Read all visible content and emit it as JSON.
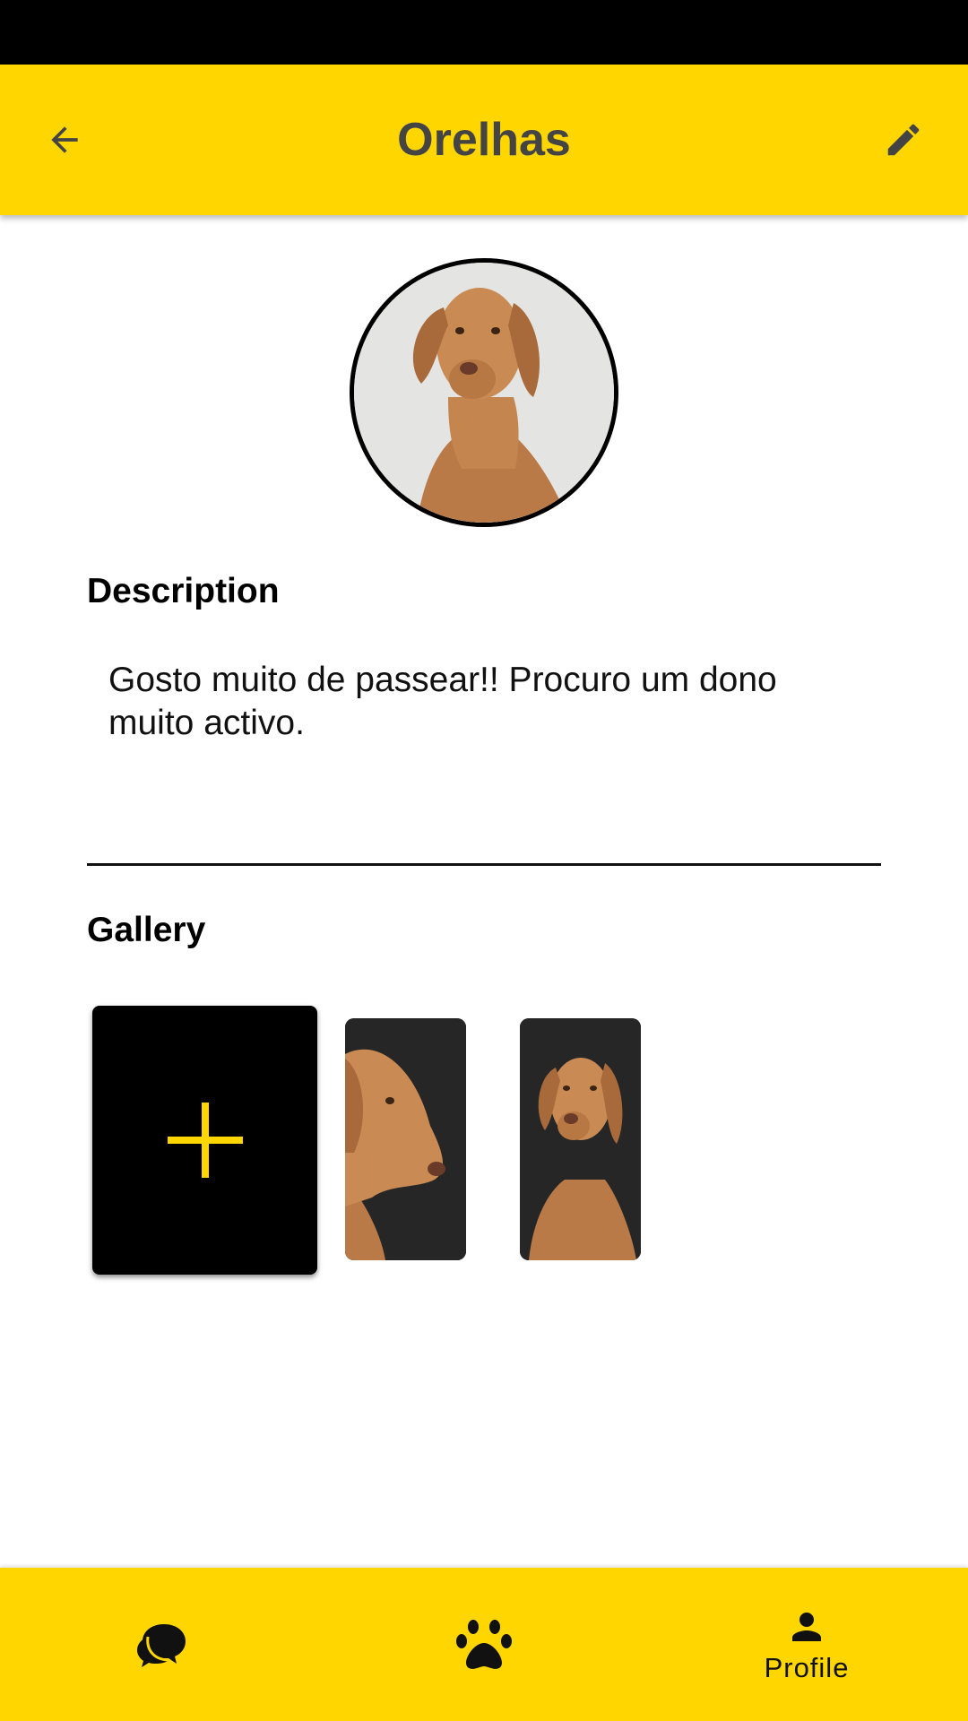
{
  "app_bar": {
    "title": "Orelhas",
    "back_icon": "arrow-back-icon",
    "edit_icon": "pencil-icon",
    "color": "#FFD600"
  },
  "profile": {
    "avatar": "dog-photo"
  },
  "description": {
    "heading": "Description",
    "text": "Gosto muito de passear!! Procuro um dono muito activo."
  },
  "gallery": {
    "heading": "Gallery",
    "add_icon": "plus-icon",
    "add_icon_color": "#FFD600",
    "photos": [
      "dog-photo-side",
      "dog-photo-front"
    ]
  },
  "bottom_nav": {
    "items": [
      {
        "icon": "chat-icon",
        "label": ""
      },
      {
        "icon": "paw-icon",
        "label": ""
      },
      {
        "icon": "person-icon",
        "label": "Profile"
      }
    ],
    "selected": "Profile"
  }
}
